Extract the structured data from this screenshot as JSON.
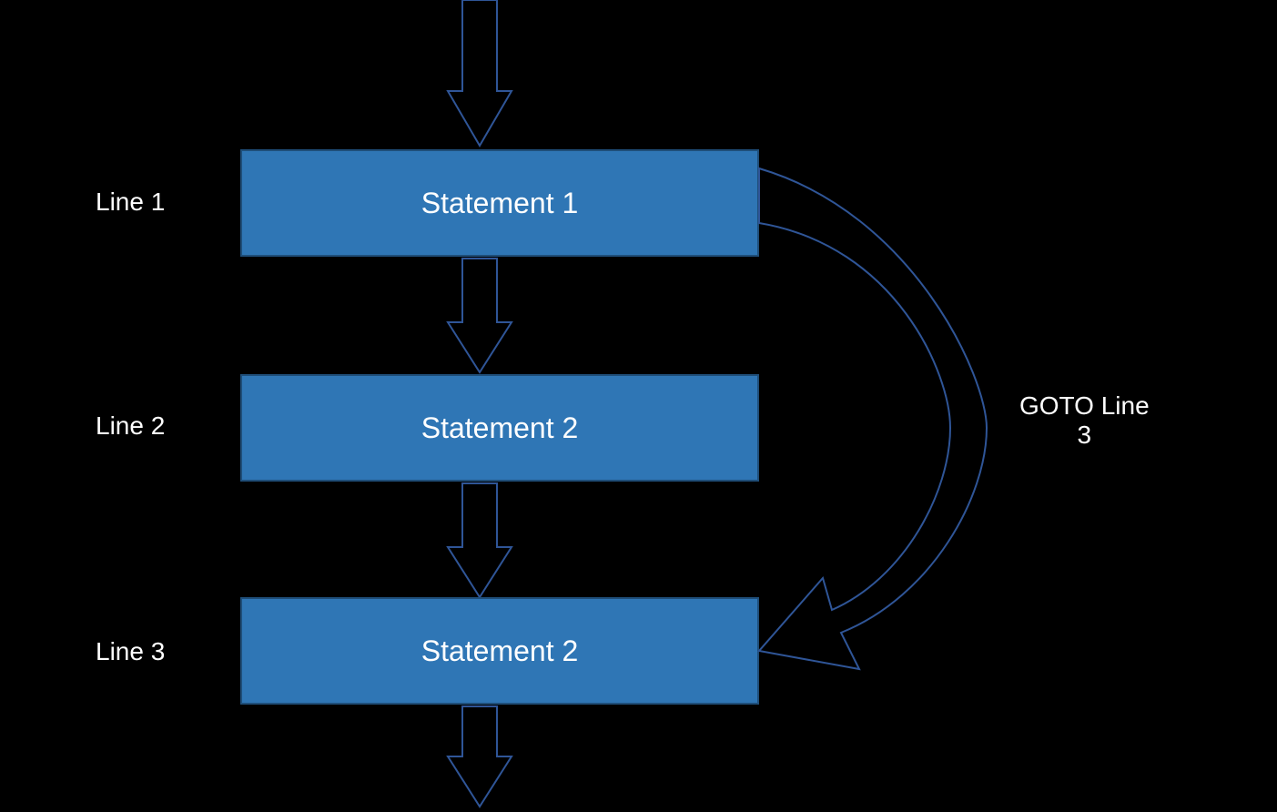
{
  "boxes": {
    "b1": "Statement 1",
    "b2": "Statement 2",
    "b3": "Statement 2"
  },
  "labels": {
    "l1": "Line 1",
    "l2": "Line 2",
    "l3": "Line 3",
    "goto": "GOTO Line\n3"
  },
  "colors": {
    "boxFill": "#2f76b5",
    "boxStroke": "#1f4e79",
    "arrowStroke": "#2f5597"
  }
}
